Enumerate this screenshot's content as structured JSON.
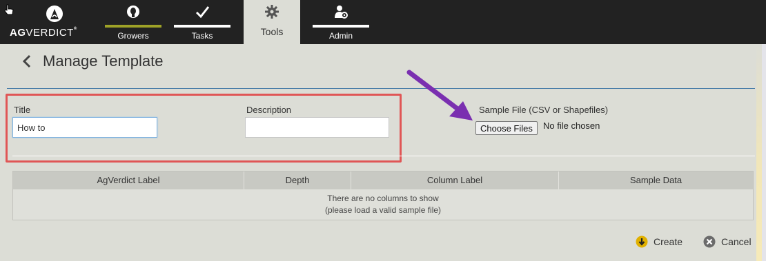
{
  "brand": {
    "logo_bold": "AG",
    "logo_light": "VERDICT",
    "logo_mark": "®"
  },
  "nav": {
    "tabs": [
      {
        "label": "Growers",
        "icon": "person-head-icon"
      },
      {
        "label": "Tasks",
        "icon": "checkmark-icon"
      },
      {
        "label": "Tools",
        "icon": "gear-icon",
        "active": true
      },
      {
        "label": "Admin",
        "icon": "user-settings-icon"
      }
    ],
    "accent": "#9ea227"
  },
  "page": {
    "title": "Manage Template"
  },
  "form": {
    "title_label": "Title",
    "title_value": "How to",
    "description_label": "Description",
    "description_value": "",
    "sample_label": "Sample File (CSV or Shapefiles)",
    "choose_button": "Choose Files",
    "file_status": "No file chosen"
  },
  "table": {
    "columns": [
      "AgVerdict Label",
      "Depth",
      "Column Label",
      "Sample Data"
    ],
    "empty_line1": "There are no columns to show",
    "empty_line2": "(please load a valid sample file)"
  },
  "actions": {
    "create": "Create",
    "cancel": "Cancel"
  },
  "colors": {
    "topbar": "#222222",
    "panel": "#dcddd6",
    "highlight_box": "#e05656",
    "arrow": "#7a2fb0",
    "create_icon": "#e0b000"
  }
}
